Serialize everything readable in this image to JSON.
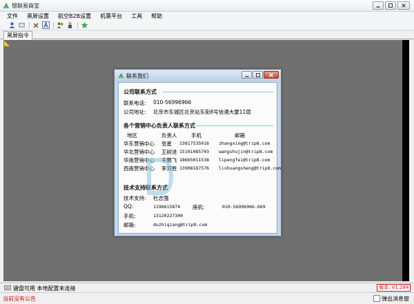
{
  "window": {
    "title": "银联易商宝",
    "app_icon": "app-leaf-icon"
  },
  "menu": [
    "文件",
    "黑屏设置",
    "航空B2B设置",
    "机票平台",
    "工具",
    "帮助"
  ],
  "toolbar_icons": [
    "user-icon",
    "settings-icon",
    "tools-icon",
    "font-icon",
    "people-icon",
    "agent-icon",
    "gear-star-icon"
  ],
  "tab": {
    "label": "黑屏指令"
  },
  "dialog": {
    "title": "联系我们",
    "company": {
      "heading": "公司联系方式",
      "phone_label": "联系电话:",
      "phone": "010-56996966",
      "address_label": "公司地址:",
      "address": "北京市东城区北京站东街8号信通大厦11层"
    },
    "sales": {
      "heading": "各个营销中心负责人联系方式",
      "headers": [
        "地区",
        "负责人",
        "手机",
        "邮箱"
      ],
      "rows": [
        [
          "华东营销中心",
          "张星",
          "13817535016",
          "zhangxing@trip8.com"
        ],
        [
          "华北营销中心",
          "王树进",
          "15101085703",
          "wangshujin@trip8.com"
        ],
        [
          "华南营销中心",
          "李鹏飞",
          "18665011538",
          "lipengfei@trip8.com"
        ],
        [
          "西南营销中心",
          "李双胜",
          "13908187576",
          "lishuangsheng@trip8.com"
        ]
      ]
    },
    "tech": {
      "heading": "技术支持联系方式",
      "support_label": "技术支持:",
      "support_name": "杜志强",
      "qq_label": "QQ:",
      "qq": "1196615874",
      "landline_label": "座机:",
      "landline": "010-56996966-669",
      "mobile_label": "手机:",
      "mobile": "13120227300",
      "email_label": "邮箱:",
      "email": "duzhiqiang@trip8.com"
    }
  },
  "status": {
    "text": "键盘可用 本地配置未连接",
    "version": "版本: V1.284",
    "announcement": "当前没有公告",
    "popup_label": "弹出消息窗"
  },
  "colors": {
    "main_bg": "#707070",
    "accent_red": "#d01010",
    "section_line": "#8fc3d8"
  }
}
